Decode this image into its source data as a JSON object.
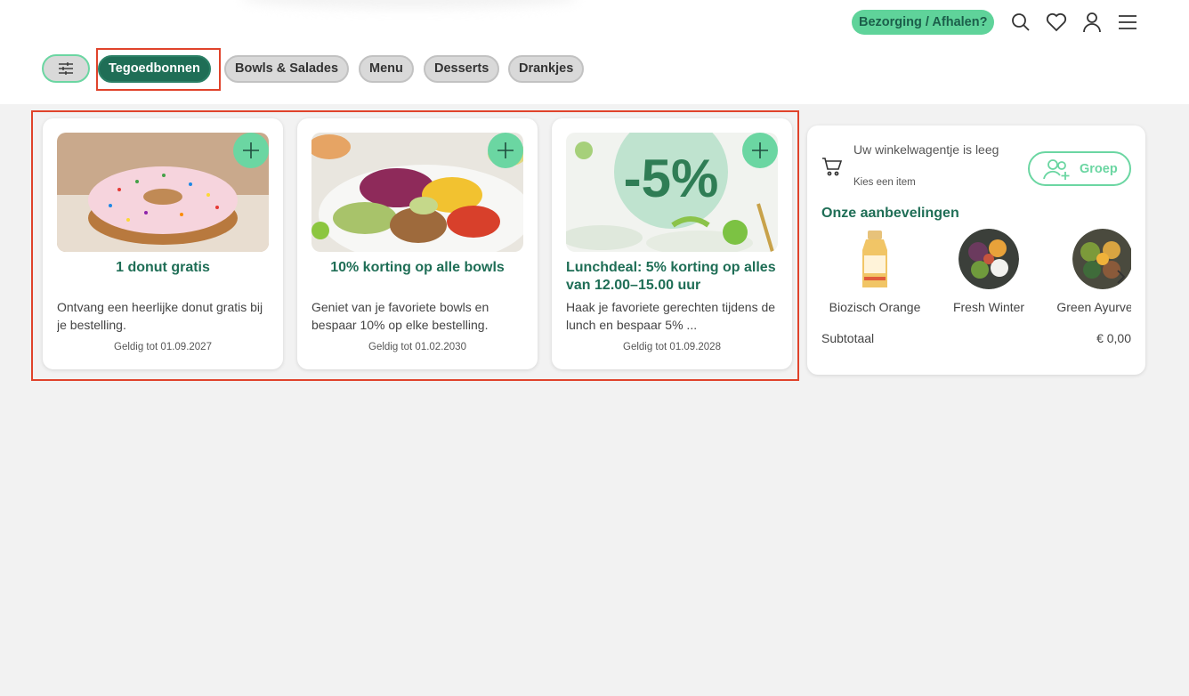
{
  "header": {
    "delivery_label": "Bezorging / Afhalen?",
    "icons": [
      "search-icon",
      "heart-icon",
      "user-icon",
      "menu-icon"
    ]
  },
  "categories": [
    {
      "label": "Tegoedbonnen",
      "active": true
    },
    {
      "label": "Bowls & Salades",
      "active": false
    },
    {
      "label": "Menu",
      "active": false
    },
    {
      "label": "Desserts",
      "active": false
    },
    {
      "label": "Drankjes",
      "active": false
    }
  ],
  "offers": [
    {
      "title": "1 donut gratis",
      "description": "Ontvang een heerlijke donut gratis bij je bestelling.",
      "valid": "Geldig tot 01.09.2027",
      "image": "donut-image"
    },
    {
      "title": "10% korting op alle bowls",
      "description": "Geniet van je favoriete bowls en bespaar 10% op elke bestelling.",
      "valid": "Geldig tot 01.02.2030",
      "image": "bowl-image"
    },
    {
      "title": "Lunchdeal: 5% korting op alles van 12.00–15.00 uur",
      "description": "Haak je favoriete gerechten tijdens de lunch en bespaar 5% ...",
      "valid": "Geldig tot 01.09.2028",
      "image": "discount-5-image",
      "image_text": "-5%"
    }
  ],
  "cart": {
    "empty_text": "Uw winkelwagentje is leeg",
    "sub_text": "Kies een item",
    "group_label": "Groep",
    "recommendations_title": "Onze aanbevelingen",
    "recommendations": [
      {
        "name": "Biozisch Orange",
        "image": "bottle-image"
      },
      {
        "name": "Fresh Winter",
        "image": "bowl-image"
      },
      {
        "name": "Green Ayurvedic",
        "image": "bowl-image"
      }
    ],
    "subtotal_label": "Subtotaal",
    "subtotal_value": "€ 0,00"
  },
  "colors": {
    "brand_dark": "#1f6e56",
    "brand_light": "#6bd6a2",
    "highlight_frame": "#e0432b"
  }
}
